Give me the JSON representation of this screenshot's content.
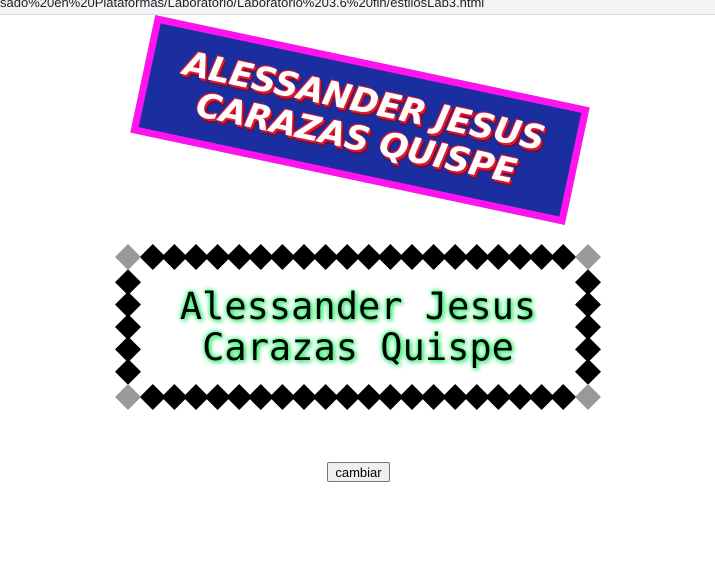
{
  "browser": {
    "url": "sado%20en%20Plataformas/Laboratorio/Laboratorio%203.6%20fin/estilosLab3.html"
  },
  "banner": {
    "line1": "ALESSANDER JESUS",
    "line2": "CARAZAS QUISPE",
    "background_color": "#1a2ea0",
    "border_color": "#ff14f0",
    "text_shadow_color": "#e0182a"
  },
  "framed_name": {
    "line1": "Alessander Jesus",
    "line2": "Carazas Quispe",
    "glow_color": "#35ff78",
    "border_pattern": "black-diamond-chain",
    "corner_color": "#999999"
  },
  "controls": {
    "change_label": "cambiar"
  }
}
